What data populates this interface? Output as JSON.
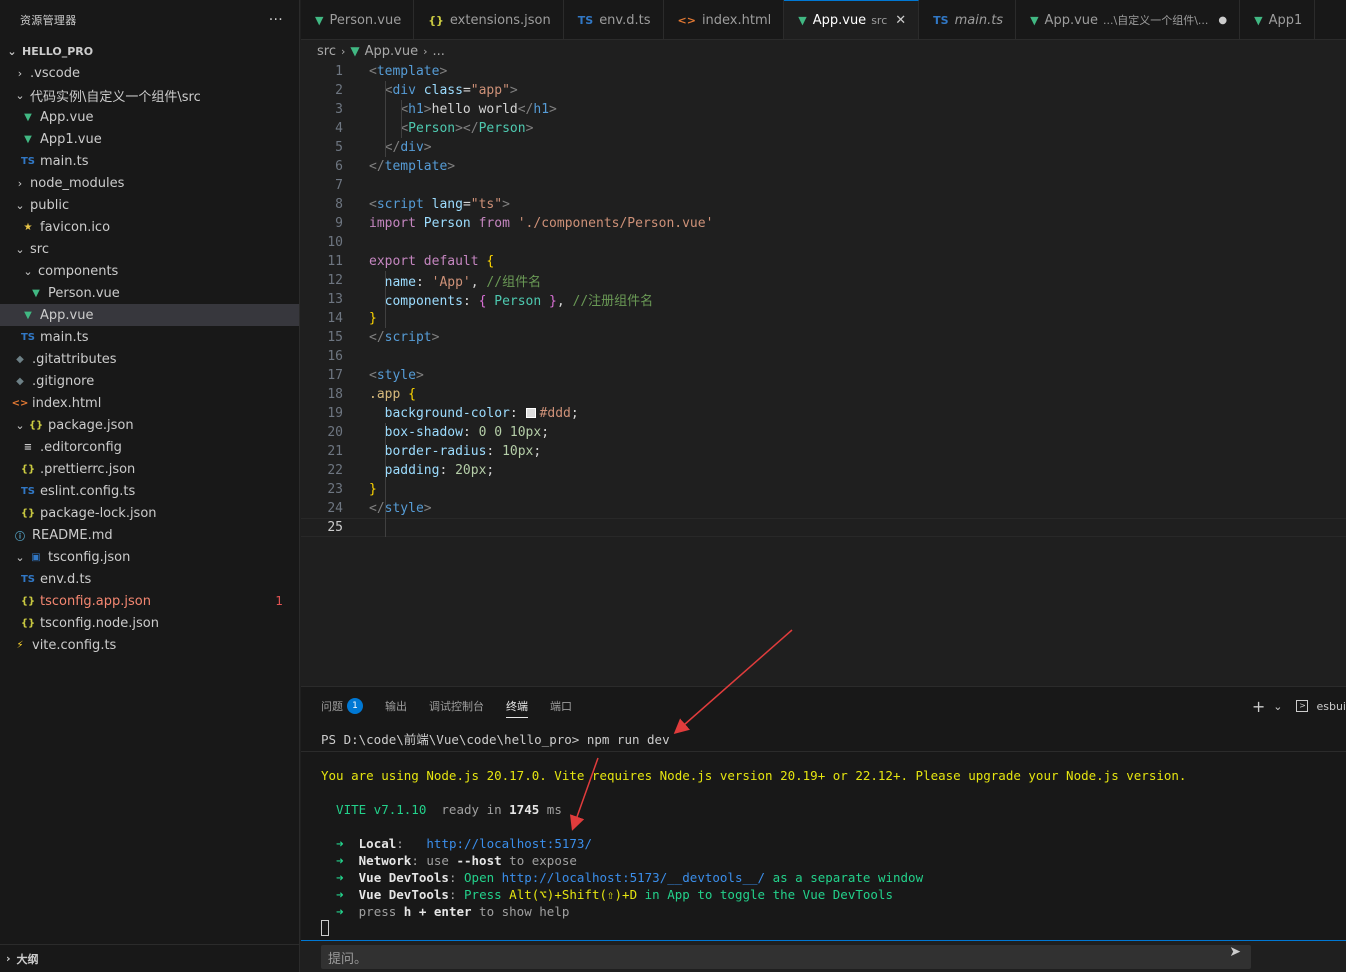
{
  "sidebar": {
    "title": "资源管理器",
    "more": "···",
    "outline_label": "大纲",
    "tree": [
      {
        "label": "HELLO_PRO",
        "kind": "root",
        "chev": "⌄",
        "icon": ""
      },
      {
        "label": ".vscode",
        "kind": "folder",
        "chev": "›",
        "icon": ""
      },
      {
        "label": "代码实例\\自定义一个组件\\src",
        "kind": "folder",
        "chev": "⌄",
        "icon": ""
      },
      {
        "label": "App.vue",
        "kind": "file",
        "chev": "",
        "icon": "vue"
      },
      {
        "label": "App1.vue",
        "kind": "file",
        "chev": "",
        "icon": "vue"
      },
      {
        "label": "main.ts",
        "kind": "file",
        "chev": "",
        "icon": "ts"
      },
      {
        "label": "node_modules",
        "kind": "folder",
        "chev": "›",
        "icon": ""
      },
      {
        "label": "public",
        "kind": "folder",
        "chev": "⌄",
        "icon": ""
      },
      {
        "label": "favicon.ico",
        "kind": "file",
        "chev": "",
        "icon": "star"
      },
      {
        "label": "src",
        "kind": "folder",
        "chev": "⌄",
        "icon": ""
      },
      {
        "label": "components",
        "kind": "folder",
        "chev": "⌄",
        "icon": ""
      },
      {
        "label": "Person.vue",
        "kind": "file",
        "chev": "",
        "icon": "vue"
      },
      {
        "label": "App.vue",
        "kind": "file",
        "chev": "",
        "icon": "vue",
        "selected": true
      },
      {
        "label": "main.ts",
        "kind": "file",
        "chev": "",
        "icon": "ts"
      },
      {
        "label": ".gitattributes",
        "kind": "file",
        "chev": "",
        "icon": "git"
      },
      {
        "label": ".gitignore",
        "kind": "file",
        "chev": "",
        "icon": "git"
      },
      {
        "label": "index.html",
        "kind": "file",
        "chev": "",
        "icon": "html"
      },
      {
        "label": "package.json",
        "kind": "folder",
        "chev": "⌄",
        "icon": "json"
      },
      {
        "label": ".editorconfig",
        "kind": "file",
        "chev": "",
        "icon": "cfg"
      },
      {
        "label": ".prettierrc.json",
        "kind": "file",
        "chev": "",
        "icon": "json"
      },
      {
        "label": "eslint.config.ts",
        "kind": "file",
        "chev": "",
        "icon": "ts"
      },
      {
        "label": "package-lock.json",
        "kind": "file",
        "chev": "",
        "icon": "json"
      },
      {
        "label": "README.md",
        "kind": "file",
        "chev": "",
        "icon": "info"
      },
      {
        "label": "tsconfig.json",
        "kind": "folder",
        "chev": "⌄",
        "icon": "tsconfig"
      },
      {
        "label": "env.d.ts",
        "kind": "file",
        "chev": "",
        "icon": "ts"
      },
      {
        "label": "tsconfig.app.json",
        "kind": "file",
        "chev": "",
        "icon": "json",
        "error": true,
        "badge": "1"
      },
      {
        "label": "tsconfig.node.json",
        "kind": "file",
        "chev": "",
        "icon": "json"
      },
      {
        "label": "vite.config.ts",
        "kind": "file",
        "chev": "",
        "icon": "bolt"
      }
    ]
  },
  "tabs": [
    {
      "label": "Person.vue",
      "icon": "vue"
    },
    {
      "label": "extensions.json",
      "icon": "json"
    },
    {
      "label": "env.d.ts",
      "icon": "ts"
    },
    {
      "label": "index.html",
      "icon": "html"
    },
    {
      "label": "App.vue",
      "icon": "vue",
      "active": true,
      "desc": "src",
      "close": "✕"
    },
    {
      "label": "main.ts",
      "icon": "ts",
      "italic": true
    },
    {
      "label": "App.vue",
      "icon": "vue",
      "desc": "...\\自定义一个组件\\...",
      "dot": "●"
    },
    {
      "label": "App1",
      "icon": "vue"
    }
  ],
  "breadcrumb": {
    "folder": "src",
    "file": "App.vue",
    "rest": "..."
  },
  "editor": {
    "current_line": 25,
    "lines": [
      [
        [
          "t-punc",
          "<"
        ],
        [
          "t-tag",
          "template"
        ],
        [
          "t-punc",
          ">"
        ]
      ],
      [
        [
          "t-txt",
          "  "
        ],
        [
          "t-punc",
          "<"
        ],
        [
          "t-tag",
          "div"
        ],
        [
          "t-txt",
          " "
        ],
        [
          "t-attr",
          "class"
        ],
        [
          "t-txt",
          "="
        ],
        [
          "t-str",
          "\"app\""
        ],
        [
          "t-punc",
          ">"
        ]
      ],
      [
        [
          "t-txt",
          "    "
        ],
        [
          "t-punc",
          "<"
        ],
        [
          "t-tag",
          "h1"
        ],
        [
          "t-punc",
          ">"
        ],
        [
          "t-txt",
          "hello world"
        ],
        [
          "t-punc",
          "</"
        ],
        [
          "t-tag",
          "h1"
        ],
        [
          "t-punc",
          ">"
        ]
      ],
      [
        [
          "t-txt",
          "    "
        ],
        [
          "t-punc",
          "<"
        ],
        [
          "t-comp",
          "Person"
        ],
        [
          "t-punc",
          "></"
        ],
        [
          "t-comp",
          "Person"
        ],
        [
          "t-punc",
          ">"
        ]
      ],
      [
        [
          "t-txt",
          "  "
        ],
        [
          "t-punc",
          "</"
        ],
        [
          "t-tag",
          "div"
        ],
        [
          "t-punc",
          ">"
        ]
      ],
      [
        [
          "t-punc",
          "</"
        ],
        [
          "t-tag",
          "template"
        ],
        [
          "t-punc",
          ">"
        ]
      ],
      [],
      [
        [
          "t-punc",
          "<"
        ],
        [
          "t-tag",
          "script"
        ],
        [
          "t-txt",
          " "
        ],
        [
          "t-attr",
          "lang"
        ],
        [
          "t-txt",
          "="
        ],
        [
          "t-str",
          "\"ts\""
        ],
        [
          "t-punc",
          ">"
        ]
      ],
      [
        [
          "t-kw",
          "import"
        ],
        [
          "t-txt",
          " "
        ],
        [
          "t-attr",
          "Person"
        ],
        [
          "t-txt",
          " "
        ],
        [
          "t-kw",
          "from"
        ],
        [
          "t-txt",
          " "
        ],
        [
          "t-str",
          "'./components/Person.vue'"
        ]
      ],
      [],
      [
        [
          "t-kw",
          "export"
        ],
        [
          "t-txt",
          " "
        ],
        [
          "t-kw",
          "default"
        ],
        [
          "t-txt",
          " "
        ],
        [
          "t-brace",
          "{"
        ]
      ],
      [
        [
          "t-txt",
          "  "
        ],
        [
          "t-attr",
          "name"
        ],
        [
          "t-txt",
          ": "
        ],
        [
          "t-str",
          "'App'"
        ],
        [
          "t-txt",
          ", "
        ],
        [
          "t-cmt",
          "//组件名"
        ]
      ],
      [
        [
          "t-txt",
          "  "
        ],
        [
          "t-attr",
          "components"
        ],
        [
          "t-txt",
          ": "
        ],
        [
          "t-brace2",
          "{"
        ],
        [
          "t-txt",
          " "
        ],
        [
          "t-comp",
          "Person"
        ],
        [
          "t-txt",
          " "
        ],
        [
          "t-brace2",
          "}"
        ],
        [
          "t-txt",
          ", "
        ],
        [
          "t-cmt",
          "//注册组件名"
        ]
      ],
      [
        [
          "t-brace",
          "}"
        ]
      ],
      [
        [
          "t-punc",
          "</"
        ],
        [
          "t-tag",
          "script"
        ],
        [
          "t-punc",
          ">"
        ]
      ],
      [],
      [
        [
          "t-punc",
          "<"
        ],
        [
          "t-tag",
          "style"
        ],
        [
          "t-punc",
          ">"
        ]
      ],
      [
        [
          "t-sel",
          ".app"
        ],
        [
          "t-txt",
          " "
        ],
        [
          "t-brace",
          "{"
        ]
      ],
      [
        [
          "t-txt",
          "  "
        ],
        [
          "t-prop",
          "background-color"
        ],
        [
          "t-txt",
          ": "
        ],
        [
          "swatch",
          ""
        ],
        [
          "t-str",
          "#ddd"
        ],
        [
          "t-txt",
          ";"
        ]
      ],
      [
        [
          "t-txt",
          "  "
        ],
        [
          "t-prop",
          "box-shadow"
        ],
        [
          "t-txt",
          ": "
        ],
        [
          "t-num",
          "0"
        ],
        [
          "t-txt",
          " "
        ],
        [
          "t-num",
          "0"
        ],
        [
          "t-txt",
          " "
        ],
        [
          "t-num",
          "10px"
        ],
        [
          "t-txt",
          ";"
        ]
      ],
      [
        [
          "t-txt",
          "  "
        ],
        [
          "t-prop",
          "border-radius"
        ],
        [
          "t-txt",
          ": "
        ],
        [
          "t-num",
          "10px"
        ],
        [
          "t-txt",
          ";"
        ]
      ],
      [
        [
          "t-txt",
          "  "
        ],
        [
          "t-prop",
          "padding"
        ],
        [
          "t-txt",
          ": "
        ],
        [
          "t-num",
          "20px"
        ],
        [
          "t-txt",
          ";"
        ]
      ],
      [
        [
          "t-brace",
          "}"
        ]
      ],
      [
        [
          "t-punc",
          "</"
        ],
        [
          "t-tag",
          "style"
        ],
        [
          "t-punc",
          ">"
        ]
      ],
      []
    ]
  },
  "panel": {
    "tabs": [
      {
        "label": "问题",
        "badge": "1"
      },
      {
        "label": "输出"
      },
      {
        "label": "调试控制台"
      },
      {
        "label": "终端",
        "active": true
      },
      {
        "label": "端口"
      }
    ],
    "add_icon": "+",
    "dropdown_icon": "⌄",
    "shell_label": "esbui",
    "prompt": "PS D:\\code\\前端\\Vue\\code\\hello_pro> ",
    "command": "npm run dev",
    "terminal_lines": [
      [
        [
          "y",
          "You are using Node.js 20.17.0. Vite requires Node.js version 20.19+ or 22.12+. Please upgrade your Node.js version."
        ]
      ],
      [
        [
          "g",
          "  VITE v7.1.10"
        ],
        [
          "dim",
          "  ready in "
        ],
        [
          "w",
          "1745"
        ],
        [
          "dim",
          " ms"
        ]
      ],
      [
        [
          "g",
          "  ➜  "
        ],
        [
          "w",
          "Local"
        ],
        [
          "dim",
          ":   "
        ],
        [
          "b",
          "http://localhost:"
        ],
        [
          "b",
          "5173"
        ],
        [
          "b",
          "/"
        ]
      ],
      [
        [
          "g",
          "  ➜  "
        ],
        [
          "w",
          "Network"
        ],
        [
          "dim",
          ": use "
        ],
        [
          "w",
          "--host"
        ],
        [
          "dim",
          " to expose"
        ]
      ],
      [
        [
          "g",
          "  ➜  "
        ],
        [
          "w",
          "Vue DevTools"
        ],
        [
          "dim",
          ": "
        ],
        [
          "g",
          "Open "
        ],
        [
          "b",
          "http://localhost:5173/__devtools__/"
        ],
        [
          "g",
          " as a separate window"
        ]
      ],
      [
        [
          "g",
          "  ➜  "
        ],
        [
          "w",
          "Vue DevTools"
        ],
        [
          "dim",
          ": "
        ],
        [
          "g",
          "Press "
        ],
        [
          "y",
          "Alt(⌥)+Shift(⇧)+D"
        ],
        [
          "g",
          " in App to toggle the Vue DevTools"
        ]
      ],
      [
        [
          "g",
          "  ➜  "
        ],
        [
          "dim",
          "press "
        ],
        [
          "w",
          "h + enter"
        ],
        [
          "dim",
          " to show help"
        ]
      ]
    ],
    "chat_placeholder": "提问。",
    "send_icon": "➤"
  },
  "colors": {
    "accent": "#0078d4",
    "annotation_arrow": "#e03c3c"
  }
}
